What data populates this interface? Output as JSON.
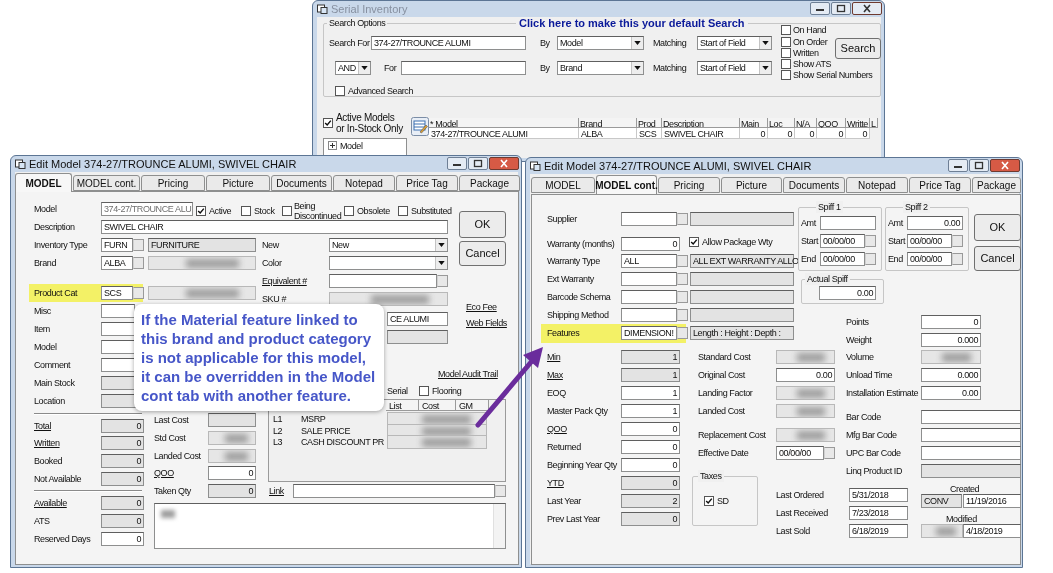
{
  "serial_inventory": {
    "title": "Serial Inventory",
    "group_label": "Search Options",
    "default_search_link": "Click here to make this your default Search",
    "search_rows": [
      {
        "label": "Search For",
        "value": "374-27/TROUNCE ALUMI",
        "by_label": "By",
        "by": "Model",
        "matching_label": "Matching",
        "matching": "Start of Field"
      },
      {
        "operator": "AND",
        "label": "For",
        "by_label": "By",
        "by": "Brand",
        "matching_label": "Matching",
        "matching": "Start of Field"
      }
    ],
    "filters": [
      {
        "label": "On Hand",
        "checked": false
      },
      {
        "label": "On Order",
        "checked": false
      },
      {
        "label": "Written",
        "checked": false
      },
      {
        "label": "Show ATS",
        "checked": false
      },
      {
        "label": "Show Serial Numbers",
        "checked": false
      }
    ],
    "search_button": "Search",
    "advanced_search": {
      "label": "Advanced Search",
      "checked": false
    },
    "active_only": {
      "label": "Active Models or In-Stock Only",
      "checked": true
    },
    "tree": [
      {
        "label": "Model",
        "expanded": false
      }
    ],
    "results": {
      "columns": [
        "* Model",
        "Brand",
        "Prod",
        "Description",
        "Main",
        "Loc",
        "N/A",
        "QOO",
        "Writte",
        "L"
      ],
      "rows": [
        [
          "374-27/TROUNCE ALUMI",
          "ALBA",
          "SCS",
          "SWIVEL CHAIR",
          "0",
          "0",
          "0",
          "0",
          "0"
        ]
      ]
    }
  },
  "model_window": {
    "title": "Edit Model 374-27/TROUNCE ALUMI, SWIVEL CHAIR",
    "tabs": [
      {
        "label": "MODEL",
        "selected": true
      },
      {
        "label": "MODEL cont.",
        "selected": false
      },
      {
        "label": "Pricing",
        "selected": false
      },
      {
        "label": "Picture",
        "selected": false
      },
      {
        "label": "Documents",
        "selected": false
      },
      {
        "label": "Notepad",
        "selected": false
      },
      {
        "label": "Price Tag",
        "selected": false
      },
      {
        "label": "Package",
        "selected": false
      }
    ],
    "model": {
      "label": "Model",
      "value": "374-27/TROUNCE ALU"
    },
    "flags": [
      {
        "label": "Active",
        "checked": true
      },
      {
        "label": "Stock",
        "checked": false
      },
      {
        "label": "Being Discontinued",
        "checked": false
      },
      {
        "label": "Obsolete",
        "checked": false
      },
      {
        "label": "Substituted",
        "checked": false
      }
    ],
    "description": {
      "label": "Description",
      "value": "SWIVEL CHAIR"
    },
    "codes": [
      {
        "label": "Inventory Type",
        "code": "FURN",
        "name": "FURNITURE",
        "highlighted": false
      },
      {
        "label": "Brand",
        "code": "ALBA",
        "highlighted": false
      },
      {
        "label": "Product Cat",
        "code": "SCS",
        "highlighted": true
      }
    ],
    "lookups": [
      {
        "label": "Misc"
      },
      {
        "label": "Item"
      },
      {
        "label": "Model"
      },
      {
        "label": "Comment"
      }
    ],
    "locations": [
      {
        "label": "Main Stock"
      },
      {
        "label": "Location"
      }
    ],
    "quantities": [
      {
        "label": "Total",
        "link": true,
        "editable": false,
        "value": "0"
      },
      {
        "label": "Written",
        "link": true,
        "editable": false,
        "value": "0"
      },
      {
        "label": "Booked",
        "link": false,
        "editable": false,
        "value": "0"
      },
      {
        "label": "Not Available",
        "link": false,
        "editable": false,
        "value": "0"
      },
      {
        "label": "Available",
        "link": true,
        "editable": false,
        "value": "0"
      },
      {
        "label": "ATS",
        "link": false,
        "editable": false,
        "value": "0"
      },
      {
        "label": "Reserved Days",
        "link": false,
        "editable": true,
        "value": "0"
      }
    ],
    "costs": [
      {
        "label": "Last Cost",
        "kind": "readonly",
        "link": false
      },
      {
        "label": "Std Cost",
        "kind": "blurred",
        "link": false
      },
      {
        "label": "Landed Cost",
        "kind": "blurred",
        "link": false
      },
      {
        "label": "QOO",
        "kind": "input",
        "link": true,
        "value": "0"
      },
      {
        "label": "Taken Qty",
        "kind": "readonly",
        "link": false,
        "value": "0"
      }
    ],
    "attributes": [
      {
        "label": "New",
        "kind": "dropdown",
        "link": false,
        "value": "New"
      },
      {
        "label": "Color",
        "kind": "dropdown",
        "link": false
      },
      {
        "label": "Equivalent #",
        "kind": "lookup",
        "link": true
      },
      {
        "label": "SKU #",
        "kind": "blurred",
        "link": false
      },
      {
        "kind": "input",
        "value": "CE ALUMI"
      },
      {
        "kind": "readonly"
      }
    ],
    "side_links": [
      "Eco Fee",
      "Web Fields"
    ],
    "audit_link": "Model Audit Trail",
    "options": [
      {
        "label": "Serial"
      },
      {
        "label": "Flooring",
        "checked": false
      }
    ],
    "price_levels": {
      "columns": [
        "List",
        "Cost",
        "GM"
      ],
      "rows": [
        {
          "level": "L1",
          "name": "MSRP"
        },
        {
          "level": "L2",
          "name": "SALE PRICE"
        },
        {
          "level": "L3",
          "name": "CASH DISCOUNT PR"
        }
      ]
    },
    "link": {
      "label": "Link"
    },
    "ok_button": "OK",
    "cancel_button": "Cancel"
  },
  "model_cont_window": {
    "title": "Edit Model 374-27/TROUNCE ALUMI, SWIVEL CHAIR",
    "tabs": [
      {
        "label": "MODEL",
        "selected": false
      },
      {
        "label": "MODEL cont.",
        "selected": true
      },
      {
        "label": "Pricing",
        "selected": false
      },
      {
        "label": "Picture",
        "selected": false
      },
      {
        "label": "Documents",
        "selected": false
      },
      {
        "label": "Notepad",
        "selected": false
      },
      {
        "label": "Price Tag",
        "selected": false
      },
      {
        "label": "Package",
        "selected": false
      }
    ],
    "fields": [
      {
        "kind": "lookup",
        "label": "Supplier",
        "highlighted": false
      },
      {
        "kind": "number",
        "label": "Warranty (months)",
        "value": "0",
        "highlighted": false
      },
      {
        "kind": "lookup",
        "label": "Warranty Type",
        "code": "ALL",
        "name": "ALL EXT WARRANTY ALLO",
        "highlighted": false
      },
      {
        "kind": "lookup",
        "label": "Ext Warranty",
        "highlighted": false
      },
      {
        "kind": "lookup",
        "label": "Barcode Schema",
        "highlighted": false
      },
      {
        "kind": "lookup",
        "label": "Shipping Method",
        "highlighted": false
      },
      {
        "kind": "lookup",
        "label": "Features",
        "code": "DIMENSION!",
        "name": "Length : Height : Depth :",
        "highlighted": true
      }
    ],
    "allow_package_wty": {
      "label": "Allow Package Wty",
      "checked": true
    },
    "quantities": [
      {
        "label": "Min",
        "link": true,
        "editable": false,
        "value": "1"
      },
      {
        "label": "Max",
        "link": true,
        "editable": false,
        "value": "1"
      },
      {
        "label": "EOQ",
        "link": false,
        "editable": true,
        "value": "1"
      },
      {
        "label": "Master Pack Qty",
        "link": false,
        "editable": true,
        "value": "1"
      },
      {
        "label": "QOO",
        "link": true,
        "editable": true,
        "value": "0"
      },
      {
        "label": "Returned",
        "link": false,
        "editable": true,
        "value": "0"
      },
      {
        "label": "Beginning Year Qty",
        "link": false,
        "editable": true,
        "value": "0"
      },
      {
        "label": "YTD",
        "link": true,
        "editable": false,
        "value": "0"
      },
      {
        "label": "Last Year",
        "link": false,
        "editable": false,
        "value": "2"
      },
      {
        "label": "Prev Last Year",
        "link": false,
        "editable": false,
        "value": "0"
      }
    ],
    "costs": [
      {
        "label": "Standard Cost",
        "kind": "blurred"
      },
      {
        "label": "Original Cost",
        "kind": "input",
        "value": "0.00"
      },
      {
        "label": "Landing Factor",
        "kind": "blurred"
      },
      {
        "label": "Landed Cost",
        "kind": "blurred"
      },
      {
        "label": "Replacement Cost",
        "kind": "blurred"
      },
      {
        "label": "Effective Date",
        "kind": "date",
        "value": "00/00/00"
      }
    ],
    "taxes": {
      "label": "Taxes",
      "items": [
        {
          "label": "SD",
          "checked": true
        }
      ]
    },
    "spiffs": [
      {
        "title": "Spiff 1",
        "amt_label": "Amt",
        "start_label": "Start",
        "start": "00/00/00",
        "end_label": "End",
        "end": "00/00/00"
      },
      {
        "title": "Spiff 2",
        "amt_label": "Amt",
        "amount": "0.00",
        "start_label": "Start",
        "start": "00/00/00",
        "end_label": "End",
        "end": "00/00/00"
      }
    ],
    "actual_spiff": {
      "label": "Actual Spiff",
      "value": "0.00"
    },
    "measures": [
      {
        "label": "Points",
        "kind": "input",
        "value": "0"
      },
      {
        "label": "Weight",
        "kind": "input",
        "value": "0.000"
      },
      {
        "label": "Volume",
        "kind": "blurred"
      },
      {
        "label": "Unload Time",
        "kind": "input",
        "value": "0.000"
      },
      {
        "label": "Installation Estimate",
        "kind": "input",
        "value": "0.00"
      }
    ],
    "codes": [
      {
        "label": "Bar Code",
        "editable": true
      },
      {
        "label": "Mfg Bar Code",
        "editable": true
      },
      {
        "label": "UPC Bar Code",
        "editable": true
      },
      {
        "label": "Linq Product ID",
        "editable": false
      }
    ],
    "dates": [
      {
        "label": "Last Ordered",
        "value": "5/31/2018"
      },
      {
        "label": "Last Received",
        "value": "7/23/2018"
      },
      {
        "label": "Last Sold",
        "value": "6/18/2019"
      }
    ],
    "created": {
      "label": "Created",
      "by": "CONV",
      "date": "11/19/2016"
    },
    "modified": {
      "label": "Modified",
      "date": "4/18/2019"
    },
    "ok_button": "OK",
    "cancel_button": "Cancel"
  },
  "callout": {
    "text": "If the Material feature linked to this brand and product category is not applicable for this model, it can be overridden in the Model cont tab with another feature."
  }
}
